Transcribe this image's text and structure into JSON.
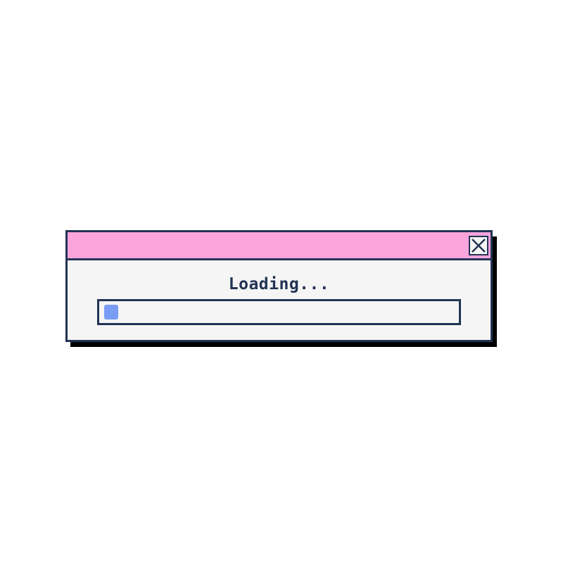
{
  "dialog": {
    "message": "Loading...",
    "close_icon": "close-x-icon",
    "progress": 0.04
  },
  "colors": {
    "titlebar": "#fca4dc",
    "border": "#223354",
    "body": "#f5f5f5",
    "progress_fill": "#7a9cf5",
    "shadow": "#000000"
  }
}
